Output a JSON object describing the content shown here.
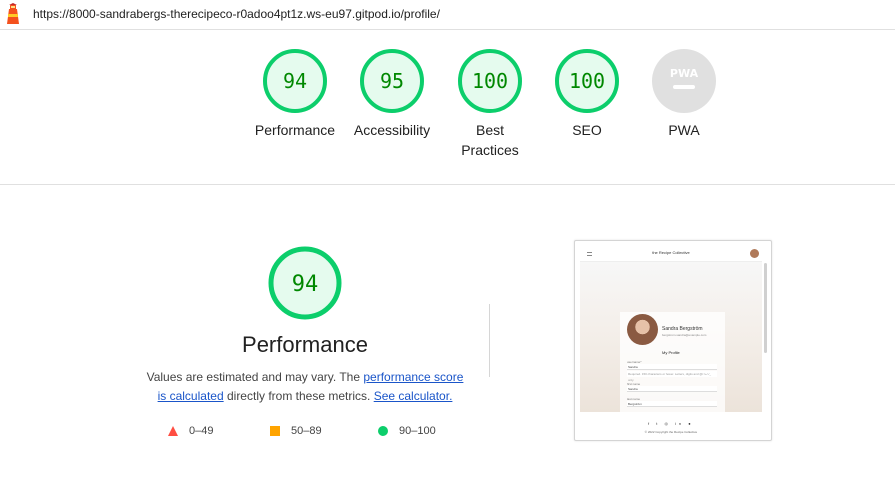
{
  "browser": {
    "url": "https://8000-sandrabergs-therecipeco-r0adoo4pt1z.ws-eu97.gitpod.io/profile/"
  },
  "colors": {
    "pass": "#0cce6b",
    "pass_text": "#008800",
    "pass_fill": "#e5fbee",
    "average": "#ffa400",
    "fail": "#ff4e42",
    "na": "#e0e0e0",
    "link": "#1a55c9"
  },
  "gauges": [
    {
      "label": "Performance",
      "score": "94"
    },
    {
      "label": "Accessibility",
      "score": "95"
    },
    {
      "label": "Best Practices",
      "score": "100"
    },
    {
      "label": "SEO",
      "score": "100"
    },
    {
      "label": "PWA",
      "score": "PWA"
    }
  ],
  "summary": {
    "score": "94",
    "title": "Performance",
    "desc_prefix": "Values are estimated and may vary. The ",
    "link1_line1": "performance score",
    "link1_line2": "is calculated",
    "desc_middle": " directly from these metrics. ",
    "link2": "See calculator."
  },
  "legend": [
    {
      "range": "0–49",
      "shape": "triangle"
    },
    {
      "range": "50–89",
      "shape": "square"
    },
    {
      "range": "90–100",
      "shape": "circle"
    }
  ],
  "screenshot": {
    "brand": "the Recipe Collective",
    "name": "Sandra Bergström",
    "email": "bergstrom.sandra@example.com",
    "heading": "My Profile",
    "fields": [
      {
        "label": "username*",
        "value": "Sandra"
      },
      {
        "label": "",
        "value": "Required. 150 characters or fewer. Letters, digits and @/./+/-/_ only."
      },
      {
        "label": "first name",
        "value": "Sandra"
      },
      {
        "label": "last name",
        "value": "Bergström"
      }
    ],
    "social": "f  t  ◎  in  ●",
    "copyright": "© 2022 Copyright the Recipe Collective"
  }
}
